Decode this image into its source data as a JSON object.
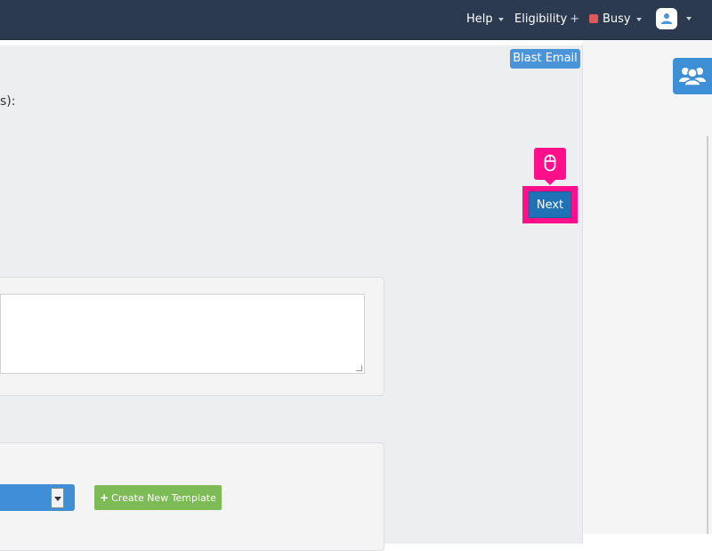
{
  "topnav": {
    "help_label": "Help",
    "eligibility_label": "Eligibility",
    "eligibility_suffix": "+",
    "status_label": "Busy",
    "status_color": "#e05858"
  },
  "toolbar": {
    "blast_email_label": "Blast Email"
  },
  "content": {
    "fragment_text": "s):"
  },
  "wizard": {
    "next_label": "Next"
  },
  "templates": {
    "create_label": "Create New Template",
    "create_icon": "plus-icon",
    "selected_value": ""
  },
  "colors": {
    "nav_bg": "#2b3a4e",
    "primary": "#1e72b5",
    "accent": "#ff0f8a",
    "success": "#7dbb57"
  }
}
